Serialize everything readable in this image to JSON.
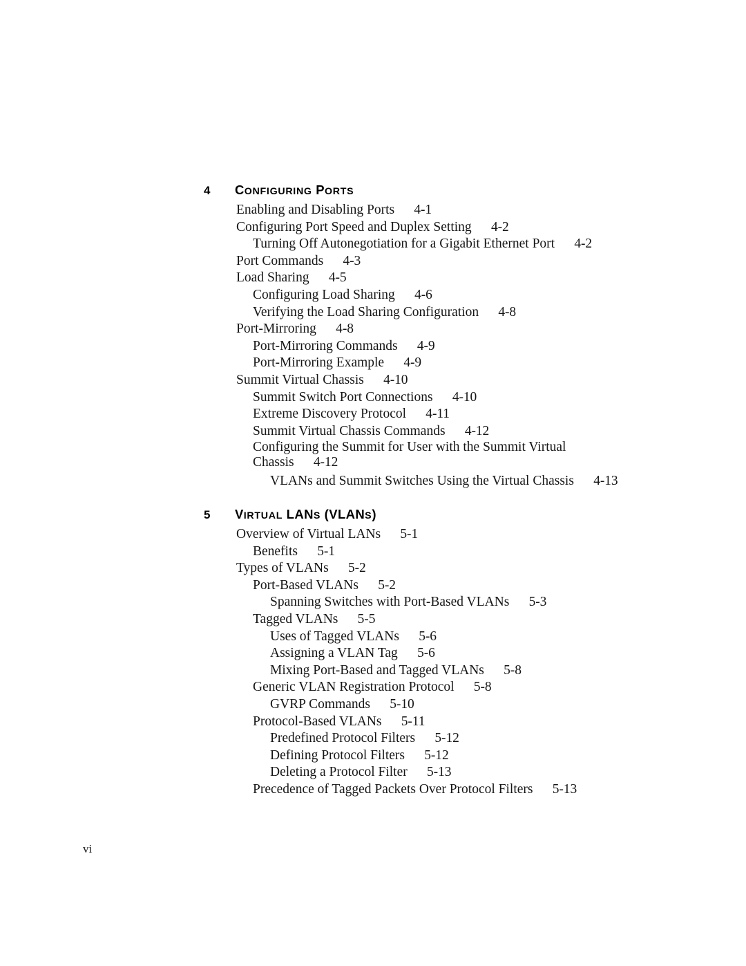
{
  "page": {
    "folio": "vi"
  },
  "chapters": [
    {
      "number": "4",
      "title_parts": [
        {
          "text": "C",
          "small": false
        },
        {
          "text": "ONFIGURING",
          "small": true
        },
        {
          "text": " P",
          "small": false
        },
        {
          "text": "ORTS",
          "small": true
        }
      ],
      "title_plain": "CONFIGURING PORTS",
      "entries": [
        {
          "level": 1,
          "title": "Enabling and Disabling Ports",
          "page": "4-1"
        },
        {
          "level": 1,
          "title": "Configuring Port Speed and Duplex Setting",
          "page": "4-2"
        },
        {
          "level": 2,
          "title": "Turning Off Autonegotiation for a Gigabit Ethernet Port",
          "page": "4-2"
        },
        {
          "level": 1,
          "title": "Port Commands",
          "page": "4-3"
        },
        {
          "level": 1,
          "title": "Load Sharing",
          "page": "4-5"
        },
        {
          "level": 2,
          "title": "Configuring Load Sharing",
          "page": "4-6"
        },
        {
          "level": 2,
          "title": "Verifying the Load Sharing Configuration",
          "page": "4-8"
        },
        {
          "level": 1,
          "title": "Port-Mirroring",
          "page": "4-8"
        },
        {
          "level": 2,
          "title": "Port-Mirroring Commands",
          "page": "4-9"
        },
        {
          "level": 2,
          "title": "Port-Mirroring Example",
          "page": "4-9"
        },
        {
          "level": 1,
          "title": "Summit Virtual Chassis",
          "page": "4-10"
        },
        {
          "level": 2,
          "title": "Summit Switch Port Connections",
          "page": "4-10"
        },
        {
          "level": 2,
          "title": "Extreme Discovery Protocol",
          "page": "4-11"
        },
        {
          "level": 2,
          "title": "Summit Virtual Chassis Commands",
          "page": "4-12"
        },
        {
          "level": 2,
          "title": "Configuring the Summit for User with the Summit Virtual",
          "page": "",
          "wrap": "top"
        },
        {
          "level": 2,
          "title": "Chassis",
          "page": "4-12",
          "wrap": "bot"
        },
        {
          "level": 3,
          "title": "VLANs and Summit Switches Using the Virtual Chassis",
          "page": "4-13"
        }
      ]
    },
    {
      "number": "5",
      "title_parts": [
        {
          "text": "V",
          "small": false
        },
        {
          "text": "IRTUAL",
          "small": true
        },
        {
          "text": " LAN",
          "small": false
        },
        {
          "text": "S",
          "small": true
        },
        {
          "text": " (VLAN",
          "small": false
        },
        {
          "text": "S",
          "small": true
        },
        {
          "text": ")",
          "small": false
        }
      ],
      "title_plain": "VIRTUAL LANs (VLANs)",
      "entries": [
        {
          "level": 1,
          "title": "Overview of Virtual LANs",
          "page": "5-1"
        },
        {
          "level": 2,
          "title": "Benefits",
          "page": "5-1"
        },
        {
          "level": 1,
          "title": "Types of VLANs",
          "page": "5-2"
        },
        {
          "level": 2,
          "title": "Port-Based VLANs",
          "page": "5-2"
        },
        {
          "level": 3,
          "title": "Spanning Switches with Port-Based VLANs",
          "page": "5-3"
        },
        {
          "level": 2,
          "title": "Tagged VLANs",
          "page": "5-5"
        },
        {
          "level": 3,
          "title": "Uses of Tagged VLANs",
          "page": "5-6"
        },
        {
          "level": 3,
          "title": "Assigning a VLAN Tag",
          "page": "5-6"
        },
        {
          "level": 3,
          "title": "Mixing Port-Based and Tagged VLANs",
          "page": "5-8"
        },
        {
          "level": 2,
          "title": "Generic VLAN Registration Protocol",
          "page": "5-8"
        },
        {
          "level": 3,
          "title": "GVRP Commands",
          "page": "5-10"
        },
        {
          "level": 2,
          "title": "Protocol-Based VLANs",
          "page": "5-11"
        },
        {
          "level": 3,
          "title": "Predefined Protocol Filters",
          "page": "5-12"
        },
        {
          "level": 3,
          "title": "Defining Protocol Filters",
          "page": "5-12"
        },
        {
          "level": 3,
          "title": "Deleting a Protocol Filter",
          "page": "5-13"
        },
        {
          "level": 2,
          "title": "Precedence of Tagged Packets Over Protocol Filters",
          "page": "5-13"
        }
      ]
    }
  ]
}
